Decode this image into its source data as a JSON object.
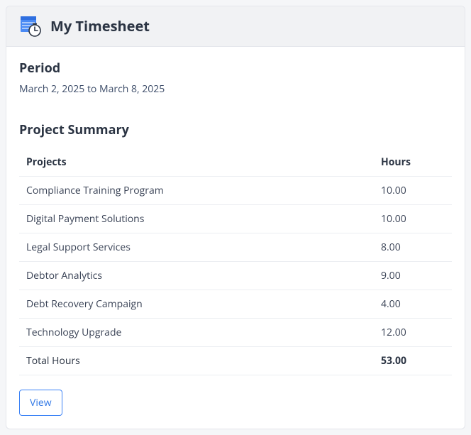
{
  "header": {
    "title": "My Timesheet"
  },
  "period": {
    "label": "Period",
    "range": "March 2, 2025 to March 8, 2025"
  },
  "summary": {
    "title": "Project Summary",
    "columns": {
      "projects": "Projects",
      "hours": "Hours"
    },
    "rows": [
      {
        "project": "Compliance Training Program",
        "hours": "10.00"
      },
      {
        "project": "Digital Payment Solutions",
        "hours": "10.00"
      },
      {
        "project": "Legal Support Services",
        "hours": "8.00"
      },
      {
        "project": "Debtor Analytics",
        "hours": "9.00"
      },
      {
        "project": "Debt Recovery Campaign",
        "hours": "4.00"
      },
      {
        "project": "Technology Upgrade",
        "hours": "12.00"
      }
    ],
    "total": {
      "label": "Total Hours",
      "hours": "53.00"
    }
  },
  "actions": {
    "view": "View"
  }
}
